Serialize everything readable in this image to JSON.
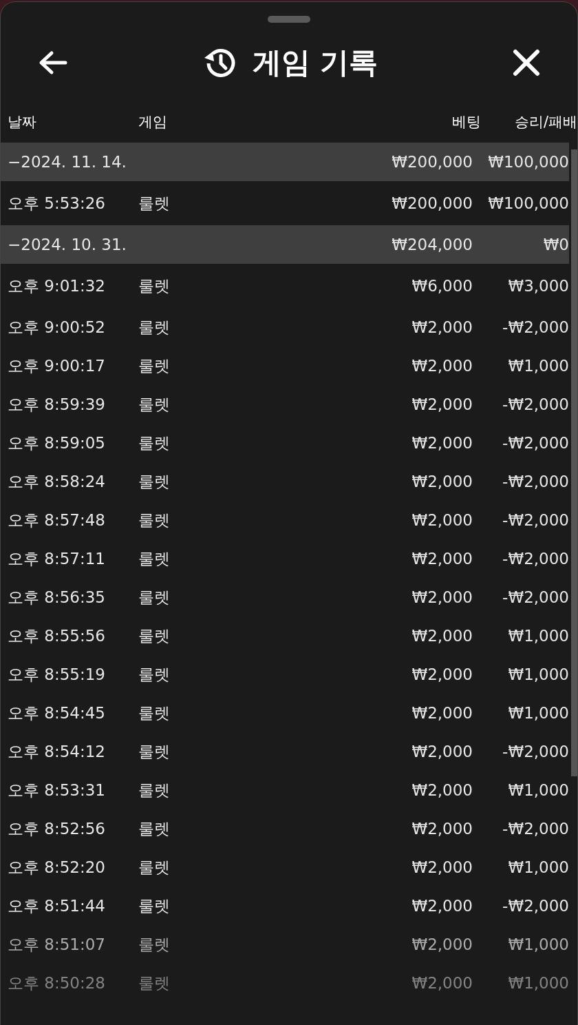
{
  "header": {
    "title": "게임 기록"
  },
  "table": {
    "columns": [
      "날짜",
      "게임",
      "베팅",
      "승리/패배"
    ],
    "rows": [
      {
        "kind": "group",
        "date": "−2024. 11. 14.",
        "bet": "₩200,000",
        "result": "₩100,000"
      },
      {
        "kind": "item",
        "date": "오후 5:53:26",
        "game": "룰렛",
        "bet": "₩200,000",
        "result": "₩100,000"
      },
      {
        "kind": "group",
        "date": "−2024. 10. 31.",
        "bet": "₩204,000",
        "result": "₩0"
      },
      {
        "kind": "item",
        "date": "오후 9:01:32",
        "game": "룰렛",
        "bet": "₩6,000",
        "result": "₩3,000"
      },
      {
        "kind": "item",
        "date": "오후 9:00:52",
        "game": "룰렛",
        "bet": "₩2,000",
        "result": "-₩2,000"
      },
      {
        "kind": "item",
        "date": "오후 9:00:17",
        "game": "룰렛",
        "bet": "₩2,000",
        "result": "₩1,000"
      },
      {
        "kind": "item",
        "date": "오후 8:59:39",
        "game": "룰렛",
        "bet": "₩2,000",
        "result": "-₩2,000"
      },
      {
        "kind": "item",
        "date": "오후 8:59:05",
        "game": "룰렛",
        "bet": "₩2,000",
        "result": "-₩2,000"
      },
      {
        "kind": "item",
        "date": "오후 8:58:24",
        "game": "룰렛",
        "bet": "₩2,000",
        "result": "-₩2,000"
      },
      {
        "kind": "item",
        "date": "오후 8:57:48",
        "game": "룰렛",
        "bet": "₩2,000",
        "result": "-₩2,000"
      },
      {
        "kind": "item",
        "date": "오후 8:57:11",
        "game": "룰렛",
        "bet": "₩2,000",
        "result": "-₩2,000"
      },
      {
        "kind": "item",
        "date": "오후 8:56:35",
        "game": "룰렛",
        "bet": "₩2,000",
        "result": "-₩2,000"
      },
      {
        "kind": "item",
        "date": "오후 8:55:56",
        "game": "룰렛",
        "bet": "₩2,000",
        "result": "₩1,000"
      },
      {
        "kind": "item",
        "date": "오후 8:55:19",
        "game": "룰렛",
        "bet": "₩2,000",
        "result": "₩1,000"
      },
      {
        "kind": "item",
        "date": "오후 8:54:45",
        "game": "룰렛",
        "bet": "₩2,000",
        "result": "₩1,000"
      },
      {
        "kind": "item",
        "date": "오후 8:54:12",
        "game": "룰렛",
        "bet": "₩2,000",
        "result": "-₩2,000"
      },
      {
        "kind": "item",
        "date": "오후 8:53:31",
        "game": "룰렛",
        "bet": "₩2,000",
        "result": "₩1,000"
      },
      {
        "kind": "item",
        "date": "오후 8:52:56",
        "game": "룰렛",
        "bet": "₩2,000",
        "result": "-₩2,000"
      },
      {
        "kind": "item",
        "date": "오후 8:52:20",
        "game": "룰렛",
        "bet": "₩2,000",
        "result": "₩1,000"
      },
      {
        "kind": "item",
        "date": "오후 8:51:44",
        "game": "룰렛",
        "bet": "₩2,000",
        "result": "-₩2,000"
      },
      {
        "kind": "item",
        "date": "오후 8:51:07",
        "game": "룰렛",
        "bet": "₩2,000",
        "result": "₩1,000"
      },
      {
        "kind": "item",
        "date": "오후 8:50:28",
        "game": "룰렛",
        "bet": "₩2,000",
        "result": "₩1,000"
      }
    ]
  }
}
